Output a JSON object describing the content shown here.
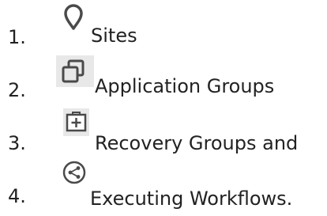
{
  "items": [
    {
      "number": "1.",
      "icon": "location-pin-icon",
      "label": "Sites"
    },
    {
      "number": "2.",
      "icon": "application-groups-icon",
      "label": "Application Groups"
    },
    {
      "number": "3.",
      "icon": "recovery-group-icon",
      "label": "Recovery Groups and"
    },
    {
      "number": "4.",
      "icon": "workflow-share-icon",
      "label": "Executing Workflows."
    }
  ],
  "colors": {
    "text": "#222222",
    "icon_stroke": "#4a4a4a",
    "icon_background": "#e8e8e8"
  }
}
